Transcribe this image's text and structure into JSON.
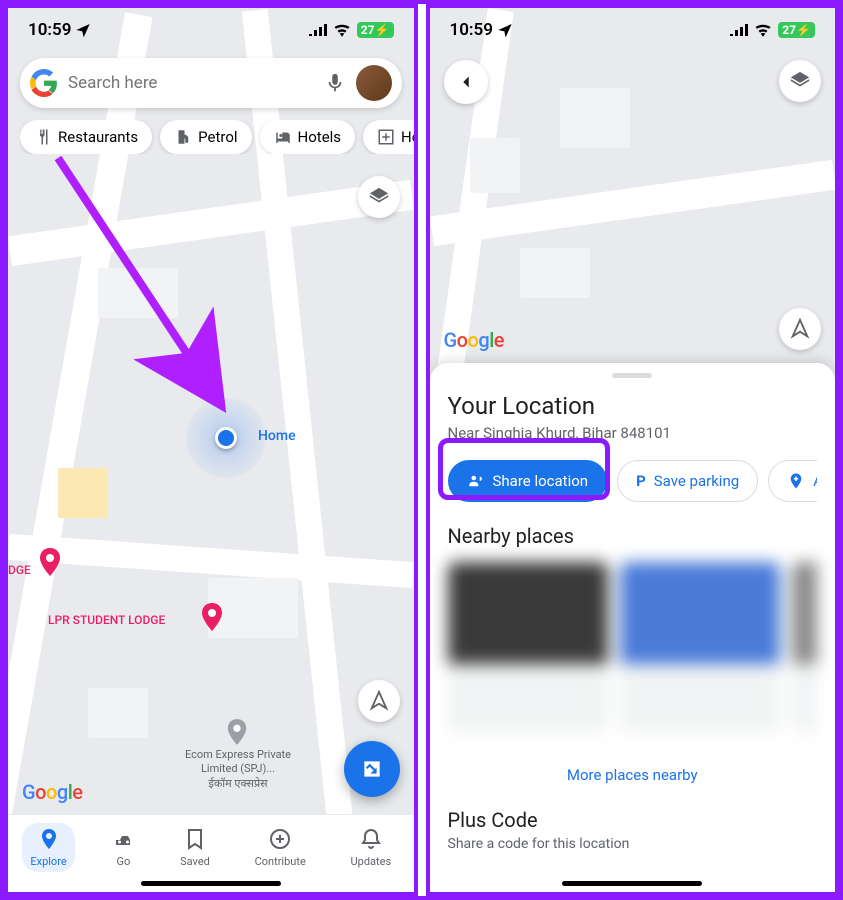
{
  "status": {
    "time": "10:59",
    "battery": "27"
  },
  "screen1": {
    "search": {
      "placeholder": "Search here"
    },
    "chips": {
      "restaurants": "Restaurants",
      "petrol": "Petrol",
      "hotels": "Hotels",
      "hospitals": "Hospitals"
    },
    "home_label": "Home",
    "poi": {
      "lodge_short": "DGE",
      "lodge_full": "LPR STUDENT LODGE"
    },
    "place": {
      "name": "Ecom Express Private Limited (SPJ)...",
      "sub": "ईकॉम एक्सप्रेस"
    },
    "nav": {
      "explore": "Explore",
      "go": "Go",
      "saved": "Saved",
      "contribute": "Contribute",
      "updates": "Updates"
    }
  },
  "screen2": {
    "sheet": {
      "title": "Your Location",
      "subtitle": "Near Singhia Khurd, Bihar 848101",
      "share": "Share location",
      "save_parking": "Save parking",
      "add": "Add",
      "nearby_title": "Nearby places",
      "more_link": "More places nearby",
      "plus_title": "Plus Code",
      "plus_sub": "Share a code for this location"
    }
  }
}
